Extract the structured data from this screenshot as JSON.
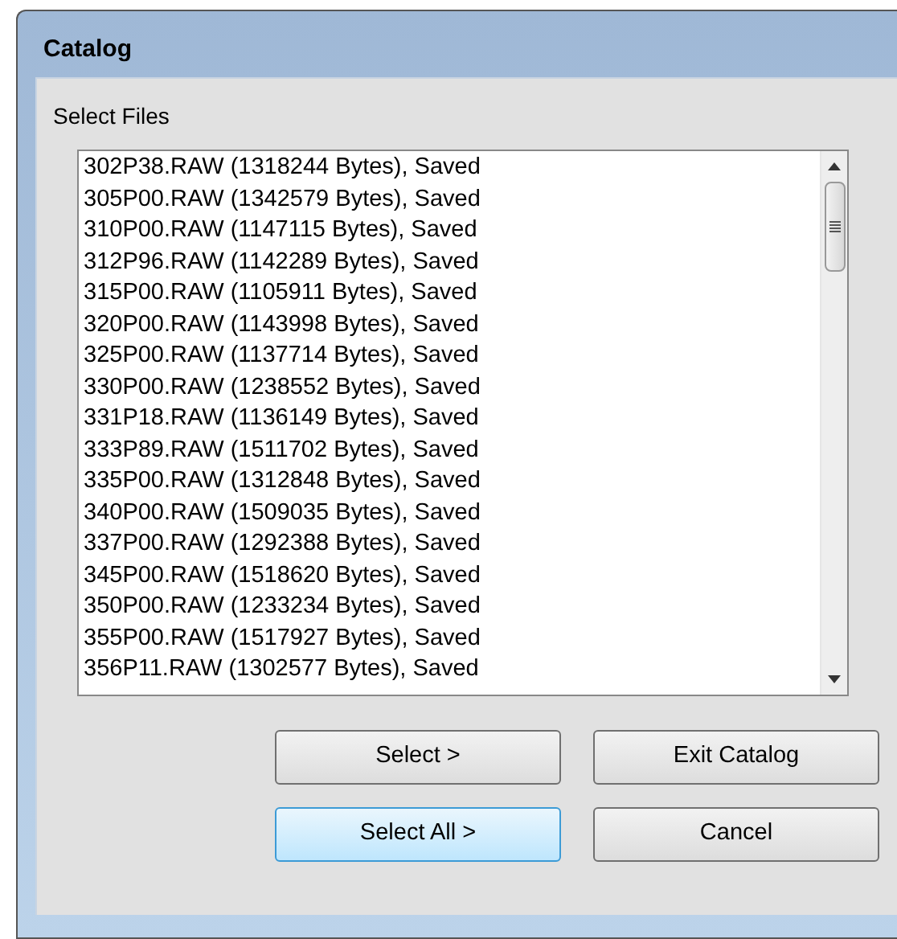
{
  "window": {
    "title": "Catalog"
  },
  "list": {
    "label": "Select Files",
    "rows": [
      "302P38.RAW (1318244 Bytes), Saved",
      "305P00.RAW (1342579 Bytes), Saved",
      "310P00.RAW (1147115 Bytes), Saved",
      "312P96.RAW (1142289 Bytes), Saved",
      "315P00.RAW (1105911 Bytes), Saved",
      "320P00.RAW (1143998 Bytes), Saved",
      "325P00.RAW (1137714 Bytes), Saved",
      "330P00.RAW (1238552 Bytes), Saved",
      "331P18.RAW (1136149 Bytes), Saved",
      "333P89.RAW (1511702 Bytes), Saved",
      "335P00.RAW (1312848 Bytes), Saved",
      "340P00.RAW (1509035 Bytes), Saved",
      "337P00.RAW (1292388 Bytes), Saved",
      "345P00.RAW (1518620 Bytes), Saved",
      "350P00.RAW (1233234 Bytes), Saved",
      "355P00.RAW (1517927 Bytes), Saved",
      "356P11.RAW (1302577 Bytes), Saved"
    ]
  },
  "buttons": [
    {
      "label": "Select >",
      "focused": false
    },
    {
      "label": "Exit Catalog",
      "focused": false
    },
    {
      "label": "Select All >",
      "focused": true
    },
    {
      "label": "Cancel",
      "focused": false
    }
  ]
}
